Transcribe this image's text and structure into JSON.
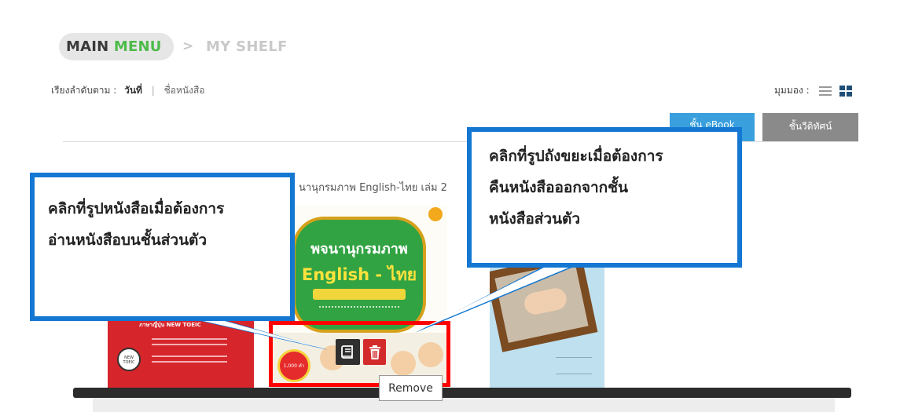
{
  "breadcrumb": {
    "main": "MAIN",
    "menu": "MENU",
    "separator": ">",
    "current": "MY SHELF"
  },
  "sort": {
    "label": "เรียงลำดับตาม :",
    "active": "วันที่",
    "separator": "|",
    "other": "ชื่อหนังสือ"
  },
  "view": {
    "label": "มุมมอง :",
    "list_icon": "list-icon",
    "grid_icon": "grid-icon"
  },
  "tabs": {
    "blue_label": "ชั้น eBook",
    "grey_label": "ชั้นวีดิทัศน์"
  },
  "book": {
    "title": "นานุกรมภาพ English-ไทย เล่ม 2"
  },
  "covers": {
    "red_title": "ภาษาญี่ปุ่น NEW TOEIC",
    "red_badge": "NEW TOEIC",
    "dict_line1": "พจนานุกรมภาพ",
    "dict_line2": "English - ไทย",
    "dict_price": "1,000 คำ"
  },
  "actions": {
    "read_icon": "book-icon",
    "trash_icon": "trash-icon",
    "tooltip": "Remove"
  },
  "callouts": {
    "left": [
      "คลิกที่รูปหนังสือเมื่อต้องการ",
      "อ่านหนังสือบนชั้นส่วนตัว"
    ],
    "right": [
      "คลิกที่รูปถังขยะเมื่อต้องการ",
      "คืนหนังสือออกจากชั้น",
      "หนังสือส่วนตัว"
    ]
  },
  "colors": {
    "callout_border": "#1477d2",
    "highlight": "#ff0000",
    "tab_blue": "#3aa0dd",
    "tab_grey": "#8a8a8a",
    "menu_green": "#4dbb4a"
  }
}
